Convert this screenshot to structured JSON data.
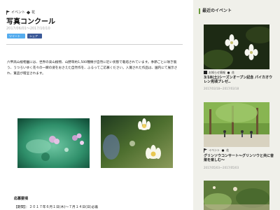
{
  "article": {
    "category": "イベント",
    "flower_label": "花",
    "title": "写真コンクール",
    "date_range": "2017/06/01〜2017/10/10",
    "share": {
      "twitter": "ツイート",
      "facebook": "シェア"
    },
    "body": "六甲高山植物園には、世界の高山植物、山野草約1,500種類が自然に近い状態で栽培されています。季節ごとに咲き競う、うつろいゆく花々の一瞬の姿をおさえた自然作を、ふるってご応募ください。入賞された作品は、園内にて展示され、賞品が贈呈されます。",
    "section_heading": "応募要項",
    "period": "【期間】：２０１７年６月１日(木)〜７月１４日(日)必着"
  },
  "sidebar": {
    "heading": "最近のイベント",
    "cards": [
      {
        "meta": "お知らせ情報",
        "flower": "花",
        "title": "3/18(土)シーズンオープン記念 パイカオウレン見頃プレゼ‥",
        "date": "2017/03/18〜2017/03/18"
      },
      {
        "meta": "イベント",
        "flower": "花",
        "title": "グリンソウコンサート〜グリンソウと共に音楽を楽しむ〜",
        "date": "2017/05/03〜2017/05/03"
      },
      {
        "meta": "",
        "flower": "",
        "title": "",
        "date": ""
      }
    ]
  },
  "colors": {
    "accent": "#6a9a3a",
    "twitter": "#55acee",
    "facebook": "#3b5998"
  }
}
